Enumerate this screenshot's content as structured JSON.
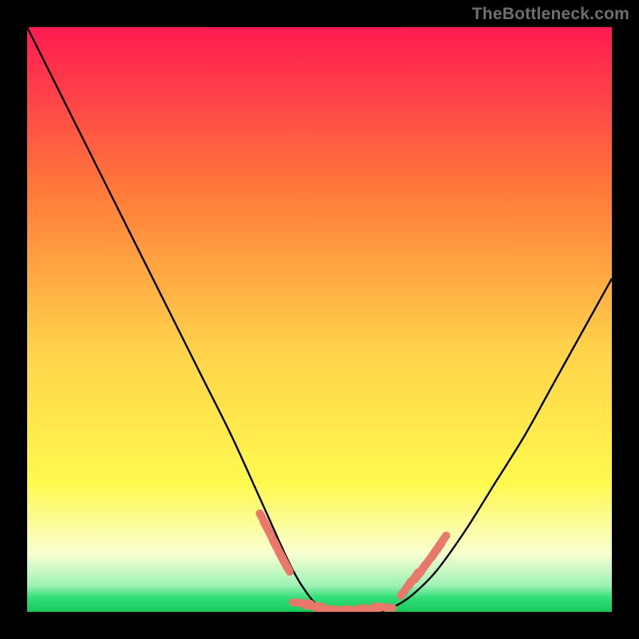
{
  "watermark": "TheBottleneck.com",
  "colors": {
    "black": "#000000",
    "curve": "#000000",
    "marker": "#e8786a",
    "grad_top": "#ff1a52",
    "grad_mid_upper": "#ff7a3a",
    "grad_mid": "#ffd24a",
    "grad_mid_lower": "#fff94f",
    "grad_pale": "#f8ffd0",
    "grad_green": "#35e07a",
    "grad_green_deep": "#17c95c"
  },
  "chart_data": {
    "type": "line",
    "title": "",
    "xlabel": "",
    "ylabel": "",
    "xlim": [
      0,
      1
    ],
    "ylim": [
      0,
      1
    ],
    "curve": {
      "x": [
        0.0,
        0.05,
        0.1,
        0.15,
        0.2,
        0.25,
        0.3,
        0.35,
        0.4,
        0.45,
        0.48,
        0.5,
        0.53,
        0.56,
        0.6,
        0.63,
        0.66,
        0.7,
        0.75,
        0.8,
        0.85,
        0.9,
        0.95,
        1.0
      ],
      "y": [
        1.0,
        0.9,
        0.8,
        0.7,
        0.6,
        0.5,
        0.4,
        0.3,
        0.19,
        0.08,
        0.03,
        0.01,
        0.0,
        0.0,
        0.0,
        0.01,
        0.03,
        0.07,
        0.14,
        0.22,
        0.3,
        0.39,
        0.48,
        0.57
      ]
    },
    "markers_left": {
      "x": [
        0.405,
        0.412,
        0.42,
        0.427,
        0.43,
        0.437,
        0.442
      ],
      "y": [
        0.155,
        0.14,
        0.125,
        0.11,
        0.105,
        0.09,
        0.082
      ]
    },
    "markers_bottom": {
      "x": [
        0.47,
        0.49,
        0.51,
        0.535,
        0.56,
        0.585,
        0.61
      ],
      "y": [
        0.015,
        0.01,
        0.005,
        0.003,
        0.003,
        0.005,
        0.008
      ]
    },
    "markers_right": {
      "x": [
        0.648,
        0.66,
        0.672,
        0.68,
        0.69,
        0.7,
        0.708
      ],
      "y": [
        0.04,
        0.055,
        0.068,
        0.078,
        0.092,
        0.105,
        0.118
      ]
    },
    "gradient_stops": [
      {
        "offset": 0.0,
        "color": "#ff1a52"
      },
      {
        "offset": 0.28,
        "color": "#ff7a3a"
      },
      {
        "offset": 0.55,
        "color": "#ffd24a"
      },
      {
        "offset": 0.78,
        "color": "#fff94f"
      },
      {
        "offset": 0.9,
        "color": "#f8ffd0"
      },
      {
        "offset": 0.955,
        "color": "#9ef2b5"
      },
      {
        "offset": 0.975,
        "color": "#35e07a"
      },
      {
        "offset": 1.0,
        "color": "#17c95c"
      }
    ]
  }
}
